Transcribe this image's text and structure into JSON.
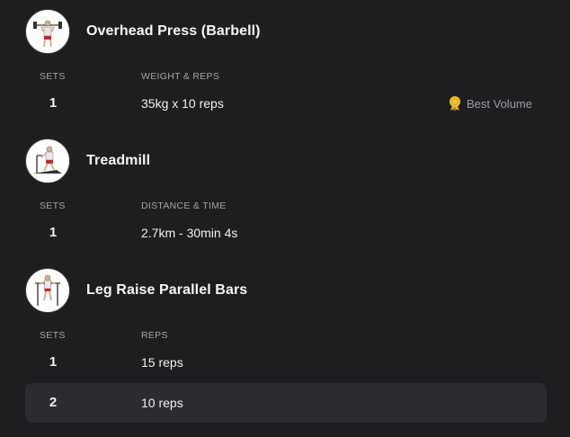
{
  "exercises": [
    {
      "title": "Overhead Press (Barbell)",
      "icon": "overhead-press-illustration",
      "col_set": "SETS",
      "col_value": "WEIGHT & REPS",
      "sets": [
        {
          "num": "1",
          "value": "35kg x 10 reps",
          "badge": "Best Volume"
        }
      ]
    },
    {
      "title": "Treadmill",
      "icon": "treadmill-illustration",
      "col_set": "SETS",
      "col_value": "DISTANCE & TIME",
      "sets": [
        {
          "num": "1",
          "value": "2.7km - 30min 4s"
        }
      ]
    },
    {
      "title": "Leg Raise Parallel Bars",
      "icon": "leg-raise-illustration",
      "col_set": "SETS",
      "col_value": "REPS",
      "sets": [
        {
          "num": "1",
          "value": "15 reps"
        },
        {
          "num": "2",
          "value": "10 reps"
        }
      ]
    }
  ],
  "colors": {
    "background": "#1e1d20",
    "row_highlight": "#2c2b2f",
    "badge_icon": "#f2c230",
    "muted_text": "#a5a5a8"
  }
}
